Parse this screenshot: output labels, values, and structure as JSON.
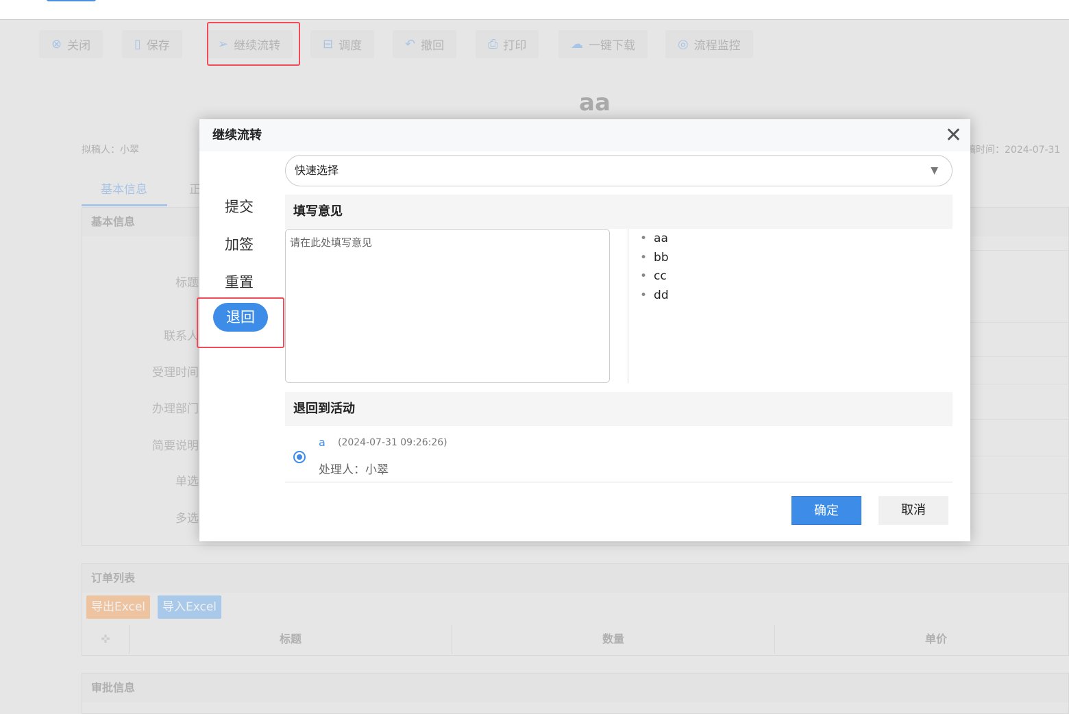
{
  "toolbar": [
    {
      "icon": "close-circle-icon",
      "label": "关闭"
    },
    {
      "icon": "save-icon",
      "label": "保存"
    },
    {
      "icon": "send-icon",
      "label": "继续流转"
    },
    {
      "icon": "schedule-icon",
      "label": "调度"
    },
    {
      "icon": "undo-icon",
      "label": "撤回"
    },
    {
      "icon": "print-icon",
      "label": "打印"
    },
    {
      "icon": "cloud-download-icon",
      "label": "一键下载"
    },
    {
      "icon": "monitor-icon",
      "label": "流程监控"
    }
  ],
  "page": {
    "title": "aa",
    "drafter": "拟稿人：小翠",
    "draft_time": "稿时间：2024-07-31",
    "tabs": [
      "基本信息",
      "正"
    ],
    "basic": {
      "header": "基本信息",
      "labels": [
        "标题",
        "联系人",
        "受理时间",
        "办理部门",
        "简要说明",
        "单选",
        "多选"
      ]
    },
    "orders": {
      "header": "订单列表",
      "export": "导出Excel",
      "import": "导入Excel",
      "columns": [
        "标题",
        "数量",
        "单价"
      ]
    },
    "approval": {
      "header": "审批信息"
    }
  },
  "modal": {
    "title": "继续流转",
    "menu": [
      "提交",
      "加签",
      "重置",
      "退回"
    ],
    "quick_select": "快速选择",
    "opinion_header": "填写意见",
    "opinion_placeholder": "请在此处填写意见",
    "common_opinions": [
      "aa",
      "bb",
      "cc",
      "dd"
    ],
    "return_header": "退回到活动",
    "activity": {
      "name": "a",
      "time": "(2024-07-31 09:26:26)",
      "handler": "处理人：小翠"
    },
    "confirm": "确定",
    "cancel": "取消"
  },
  "colors": {
    "accent": "#3d8ce8",
    "highlight": "#ef4b5a"
  }
}
